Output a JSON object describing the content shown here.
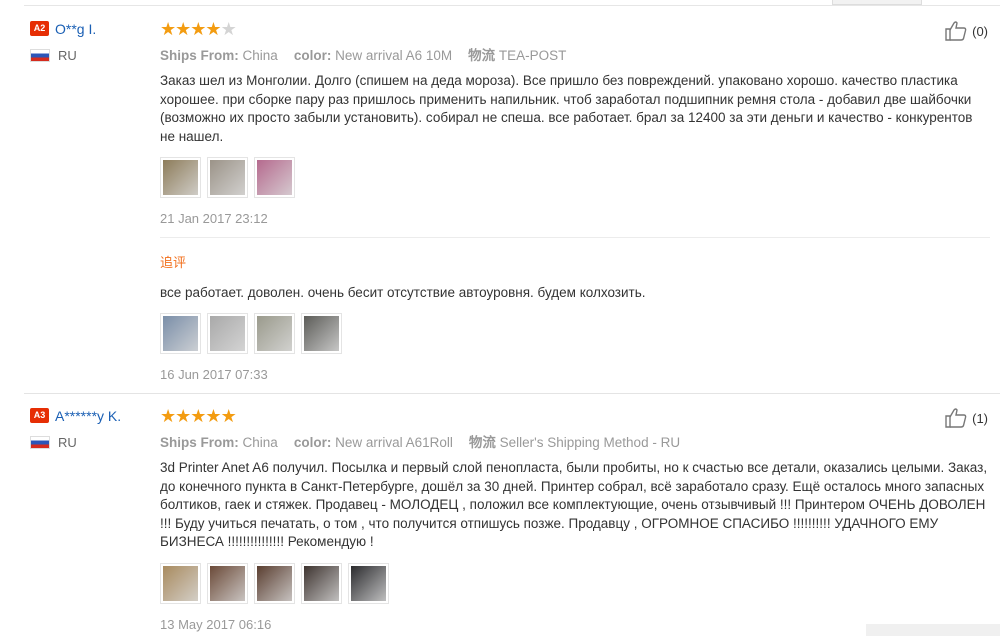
{
  "labels": {
    "ships_from": "Ships From:",
    "color": "color:",
    "logistics": "物流",
    "follow_up": "追评"
  },
  "reviews": [
    {
      "level": "A2",
      "name": "O**g I.",
      "country": "RU",
      "rating": 4,
      "rating_max": 5,
      "ships_from": "China",
      "color": "New arrival A6 10M",
      "logistics": "TEA-POST",
      "likes": "(0)",
      "text": "Заказ шел из Монголии. Долго (спишем на деда мороза). Все пришло без повреждений. упаковано хорошо. качество пластика хорошее. при сборке пару раз пришлось применить напильник. чтоб заработал подшипник ремня стола - добавил две шайбочки (возможно их просто забыли установить). собирал не спеша. все работает. брал за 12400 за эти деньги и качество - конкурентов не нашел.",
      "date": "21 Jan 2017 23:12",
      "thumb_colors": [
        "#8d7c5a",
        "#9b9388",
        "#b56a8e"
      ],
      "followup": {
        "text": "все работает. доволен. очень бесит отсутствие автоуровня. будем колхозить.",
        "date": "16 Jun 2017 07:33",
        "thumb_colors": [
          "#7a8ea8",
          "#a9a9a9",
          "#9a9a8c",
          "#5c5c58"
        ]
      }
    },
    {
      "level": "A3",
      "name": "A******y K.",
      "country": "RU",
      "rating": 5,
      "rating_max": 5,
      "ships_from": "China",
      "color": "New arrival A61Roll",
      "logistics": "Seller's Shipping Method - RU",
      "likes": "(1)",
      "text": "3d Printer Anet A6 получил. Посылка и первый слой пенопласта, были пробиты, но к счастью все детали, оказались целыми. Заказ, до конечного пункта в Санкт-Петербурге, дошёл за 30 дней. Принтер собрал, всё заработало сразу. Ещё осталось много запасных болтиков, гаек и стяжек. Продавец - МОЛОДЕЦ , положил все комплектующие, очень отзывчивый !!! Принтером ОЧЕНЬ ДОВОЛЕН !!! Буду учиться печатать, о том , что получится отпишусь позже. Продавцу , ОГРОМНОЕ СПАСИБО !!!!!!!!!! УДАЧНОГО ЕМУ БИЗНЕСА !!!!!!!!!!!!!!! Рекомендую !",
      "date": "13 May 2017 06:16",
      "thumb_colors": [
        "#a88a5e",
        "#6b4a38",
        "#5a3e30",
        "#3e3430",
        "#2b2b2e"
      ]
    }
  ]
}
